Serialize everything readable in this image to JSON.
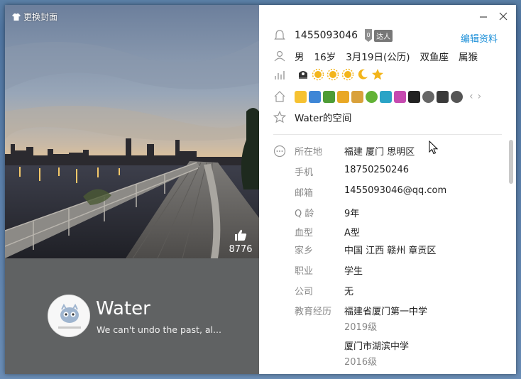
{
  "cover": {
    "change_cover_label": "更换封面",
    "like_count": "8776",
    "nickname": "Water",
    "signature": "We can't undo the past, al..."
  },
  "profile": {
    "qq_number": "1455093046",
    "vip_label": "达人",
    "edit_label": "编辑资料",
    "gender": "男",
    "age": "16岁",
    "birthday": "3月19日(公历)",
    "zodiac": "双鱼座",
    "chinese_zodiac": "属猴",
    "qzone_label": "Water的空间"
  },
  "details": [
    {
      "label": "所在地",
      "value": "福建 厦门 思明区"
    },
    {
      "label": "手机",
      "value": "18750250246"
    },
    {
      "label": "邮箱",
      "value": "1455093046@qq.com"
    },
    {
      "label": "Q 龄",
      "value": "9年"
    },
    {
      "label": "血型",
      "value": "A型"
    },
    {
      "label": "家乡",
      "value": "中国 江西 赣州 章贡区"
    },
    {
      "label": "职业",
      "value": "学生"
    },
    {
      "label": "公司",
      "value": "无"
    },
    {
      "label": "教育经历",
      "value": "福建省厦门第一中学"
    }
  ],
  "education": [
    {
      "school": "福建省厦门第一中学",
      "year": "2019级"
    },
    {
      "school": "厦门市湖滨中学",
      "year": "2016级"
    }
  ],
  "colors": {
    "accent": "#1b8fd8",
    "cover_bg": "#606263"
  }
}
